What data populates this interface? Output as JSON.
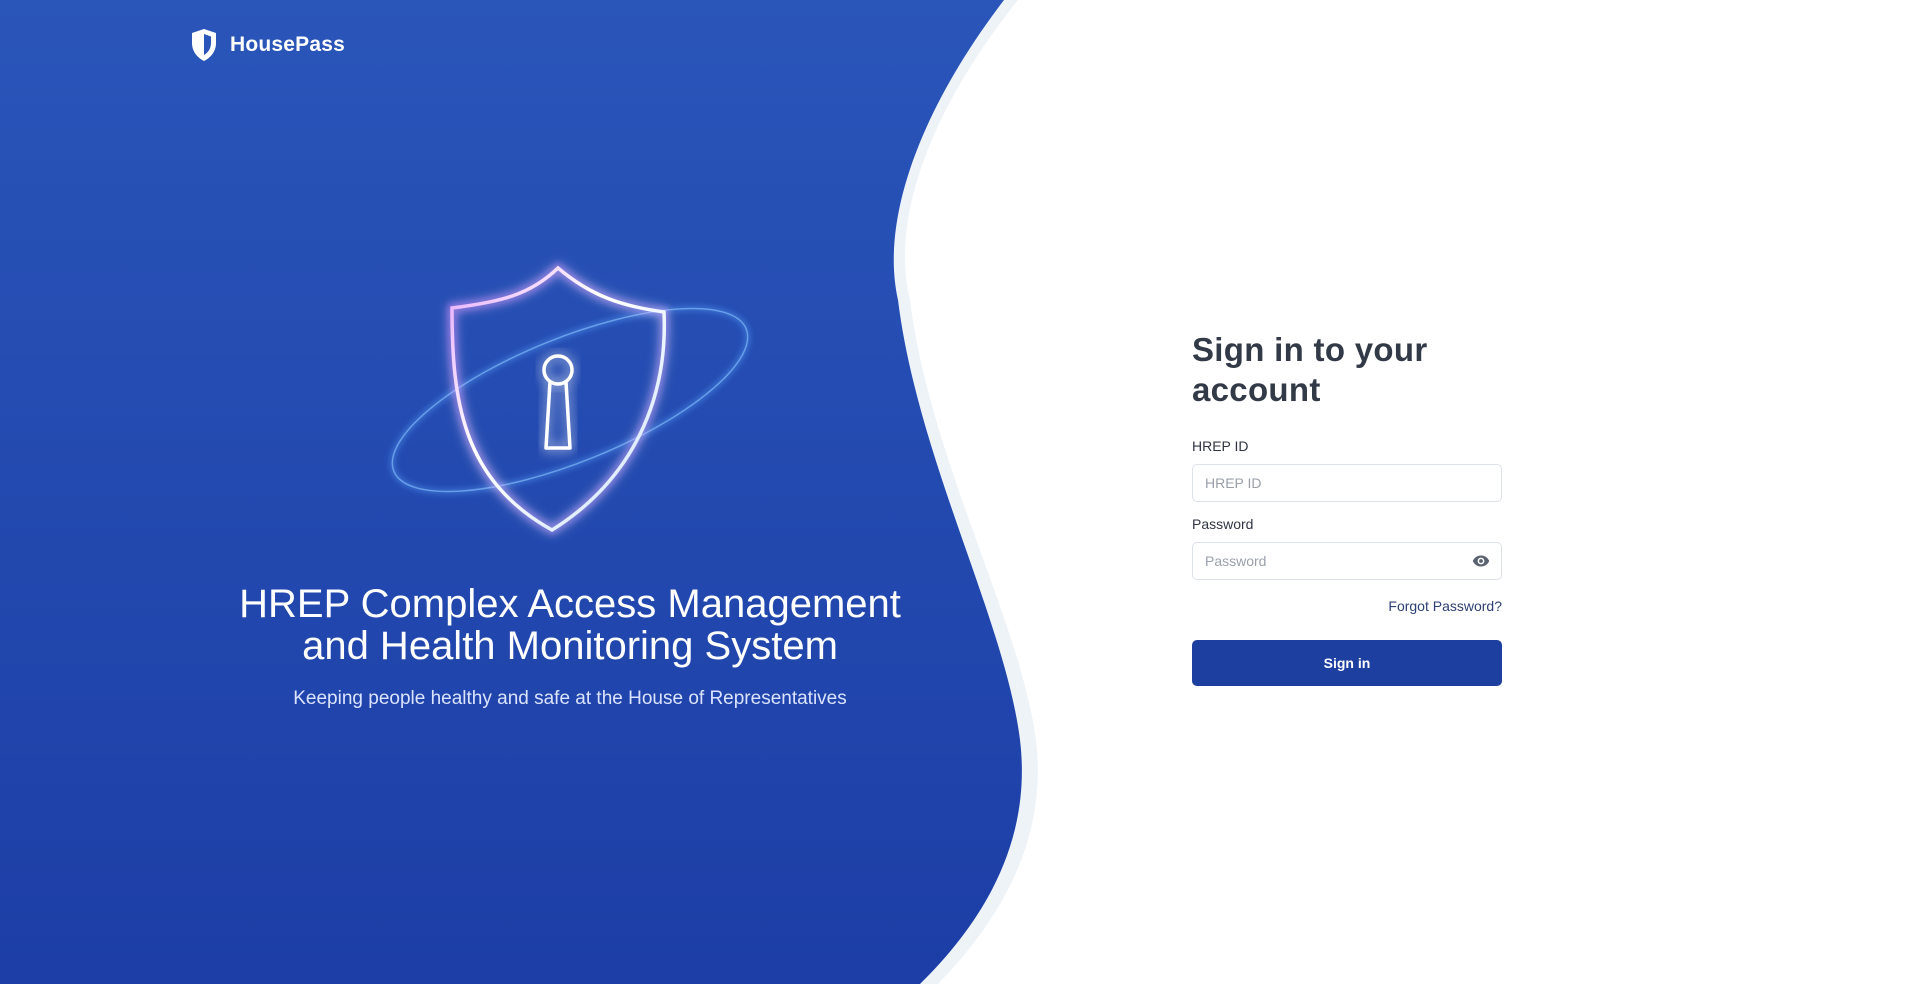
{
  "brand": {
    "name": "HousePass",
    "icon": "shield-icon"
  },
  "hero": {
    "illustration": "shield-keyhole-icon",
    "title_line1": "HREP Complex Access Management",
    "title_line2": "and Health Monitoring System",
    "subtitle": "Keeping people healthy and safe at the House of Representatives"
  },
  "form": {
    "title": "Sign in to your account",
    "hrep_id": {
      "label": "HREP ID",
      "placeholder": "HREP ID",
      "value": ""
    },
    "password": {
      "label": "Password",
      "placeholder": "Password",
      "value": "",
      "toggle_icon": "eye-icon"
    },
    "forgot_password": "Forgot Password?",
    "submit_label": "Sign in"
  },
  "colors": {
    "hero_blue": "#1e40a8",
    "button_blue": "#1c3fa0",
    "heading": "#333a47",
    "link": "#2d3f74"
  }
}
